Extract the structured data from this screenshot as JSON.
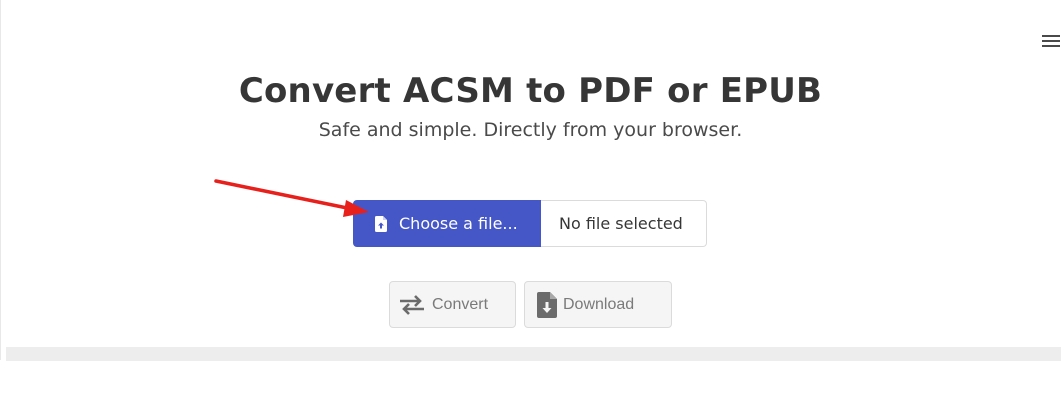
{
  "header": {
    "title": "Convert ACSM to PDF or EPUB",
    "subtitle": "Safe and simple. Directly from your browser."
  },
  "file_input": {
    "button_label": "Choose a file...",
    "file_name": "No file selected",
    "icon": "file-upload-icon"
  },
  "actions": {
    "convert_label": "Convert",
    "download_label": "Download"
  },
  "nav": {
    "menu_icon": "hamburger-menu-icon"
  },
  "annotation": {
    "arrow_color": "#e8201c"
  },
  "colors": {
    "primary": "#4557c7",
    "text": "#363636",
    "disabled_bg": "#f5f5f5",
    "disabled_text": "#7a7a7a",
    "progress_track": "#ededed"
  }
}
